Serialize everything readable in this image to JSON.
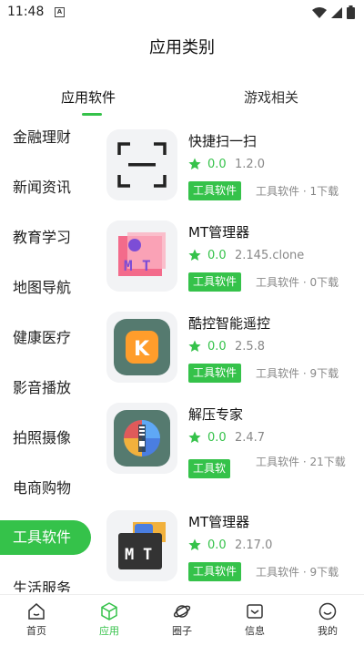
{
  "status_bar": {
    "time": "11:48",
    "a_glyph": "A"
  },
  "header": {
    "title": "应用类别"
  },
  "tabs": [
    {
      "label": "应用软件",
      "active": true
    },
    {
      "label": "游戏相关",
      "active": false
    }
  ],
  "sidebar": {
    "items": [
      {
        "label": "金融理财"
      },
      {
        "label": "新闻资讯"
      },
      {
        "label": "教育学习"
      },
      {
        "label": "地图导航"
      },
      {
        "label": "健康医疗"
      },
      {
        "label": "影音播放"
      },
      {
        "label": "拍照摄像"
      },
      {
        "label": "电商购物"
      },
      {
        "label": "工具软件",
        "active": true
      },
      {
        "label": "生活服务"
      }
    ]
  },
  "apps": [
    {
      "name": "快捷扫一扫",
      "rating": "0.0",
      "version": "1.2.0",
      "badge": "工具软件",
      "meta": "工具软件 · 1下载",
      "icon": "scan-icon"
    },
    {
      "name": "MT管理器",
      "rating": "0.0",
      "version": "2.145.clone",
      "badge": "工具软件",
      "meta": "工具软件 · 0下载",
      "icon": "mt-manager-icon"
    },
    {
      "name": "酷控智能遥控",
      "rating": "0.0",
      "version": "2.5.8",
      "badge": "工具软件",
      "meta": "工具软件 · 9下载",
      "icon": "kukong-icon"
    },
    {
      "name": "解压专家",
      "rating": "0.0",
      "version": "2.4.7",
      "badge": "工具软",
      "meta": "工具软件 · 21下载",
      "icon": "zip-icon"
    },
    {
      "name": "MT管理器",
      "rating": "0.0",
      "version": "2.17.0",
      "badge": "工具软件",
      "meta": "工具软件 · 9下载",
      "icon": "mt-manager-dark-icon"
    }
  ],
  "bottom_nav": [
    {
      "label": "首页",
      "icon": "home-icon"
    },
    {
      "label": "应用",
      "icon": "cube-icon",
      "active": true
    },
    {
      "label": "圈子",
      "icon": "planet-icon"
    },
    {
      "label": "信息",
      "icon": "message-icon"
    },
    {
      "label": "我的",
      "icon": "smile-icon"
    }
  ],
  "colors": {
    "accent": "#35c24a"
  }
}
